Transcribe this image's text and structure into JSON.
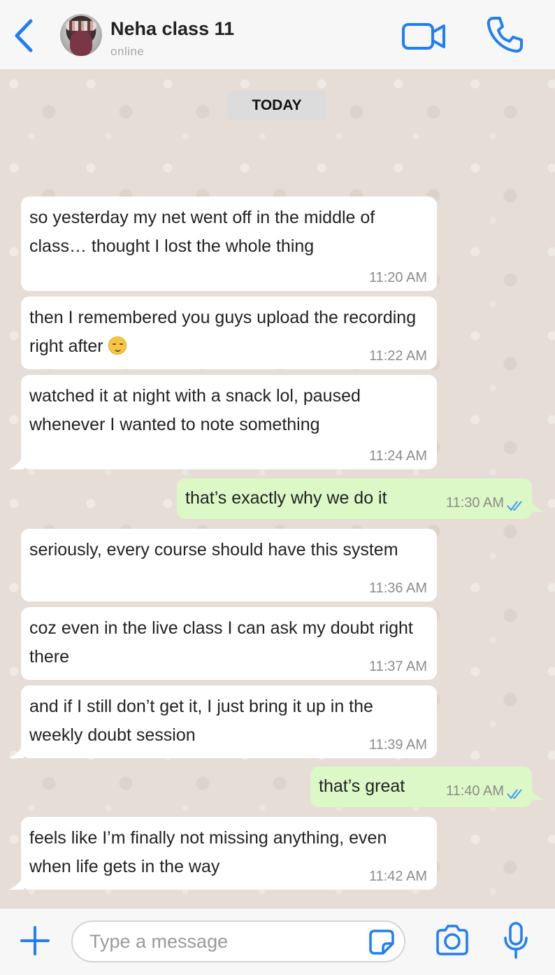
{
  "header": {
    "contact_name": "Neha class 11",
    "status": "online",
    "icons": {
      "back": "chevron-left-icon",
      "video": "video-camera-icon",
      "call": "phone-icon"
    }
  },
  "date_chip": "TODAY",
  "messages": [
    {
      "direction": "incoming",
      "text": " so yesterday my net went off in the middle of class… thought I lost the whole thing",
      "time": "11:20 AM"
    },
    {
      "direction": "incoming",
      "text": "then I remembered you guys upload the recording right after",
      "emoji": "relieved-face",
      "time": "11:22 AM"
    },
    {
      "direction": "incoming",
      "text": "watched it at night with a snack lol, paused whenever I wanted to note something",
      "time": "11:24 AM"
    },
    {
      "direction": "outgoing",
      "text": "that’s exactly why we do it",
      "time": "11:30 AM",
      "status": "read"
    },
    {
      "direction": "incoming",
      "text": "seriously, every course should have this system",
      "time": "11:36 AM"
    },
    {
      "direction": "incoming",
      "text": "coz even in the live class I can ask my doubt right there",
      "time": "11:37 AM"
    },
    {
      "direction": "incoming",
      "text": "and if I still don’t get it, I just bring it up in the weekly doubt session",
      "time": "11:39 AM"
    },
    {
      "direction": "outgoing",
      "text": "that’s great",
      "time": "11:40 AM",
      "status": "read"
    },
    {
      "direction": "incoming",
      "text": "feels like I’m finally not missing anything, even when life gets in the way",
      "time": "11:42 AM"
    }
  ],
  "composer": {
    "placeholder": "Type a message",
    "icons": {
      "add": "plus-icon",
      "sticker": "sticker-icon",
      "camera": "camera-icon",
      "mic": "microphone-icon"
    }
  },
  "colors": {
    "accent": "#1f7ef6",
    "incoming_bubble": "#ffffff",
    "outgoing_bubble": "#dcf8c6",
    "chat_background": "#e6ded6",
    "read_ticks": "#3b9cf3"
  }
}
